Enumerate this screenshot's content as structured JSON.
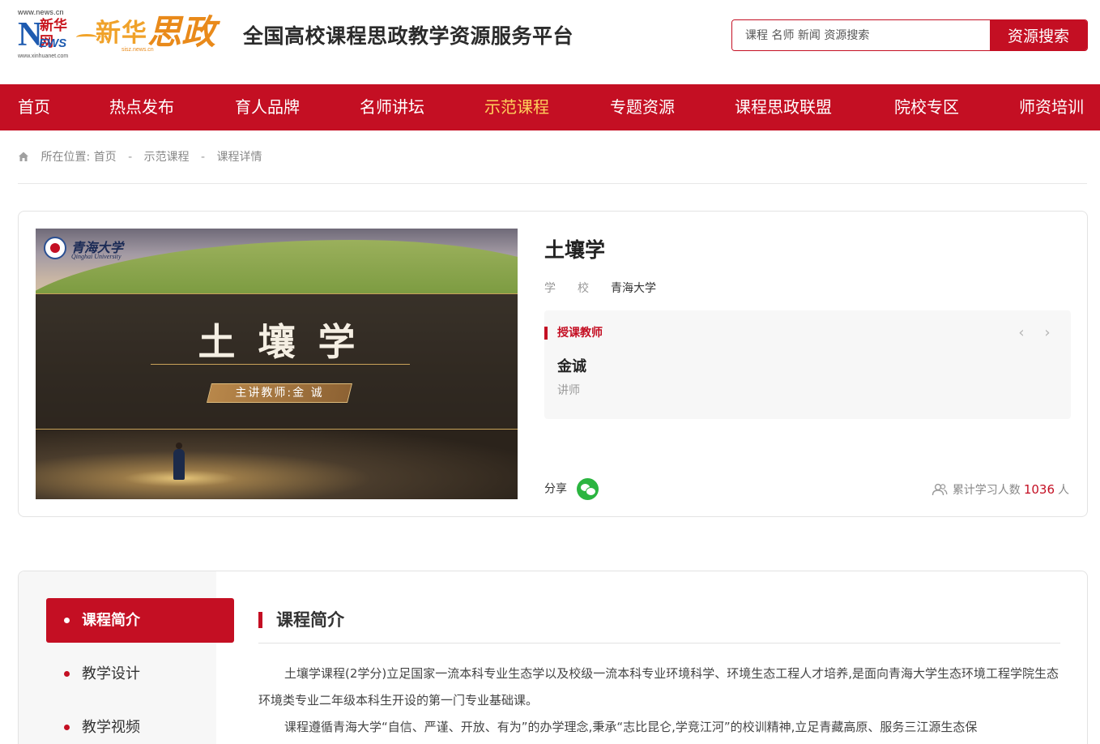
{
  "header": {
    "logo_news_url_top": "www.news.cn",
    "logo_news_cn": "新华网",
    "logo_news_en_n": "N",
    "logo_news_en_rest": "EWS",
    "logo_news_url_bottom": "www.xinhuanet.com",
    "logo_xh": "新华",
    "logo_sz": "思政",
    "logo_sz_url": "sisz.news.cn",
    "site_title": "全国高校课程思政教学资源服务平台",
    "search_placeholder": "课程 名师 新闻 资源搜索",
    "search_button": "资源搜索"
  },
  "nav": {
    "items": [
      {
        "label": "首页"
      },
      {
        "label": "热点发布"
      },
      {
        "label": "育人品牌"
      },
      {
        "label": "名师讲坛"
      },
      {
        "label": "示范课程"
      },
      {
        "label": "专题资源"
      },
      {
        "label": "课程思政联盟"
      },
      {
        "label": "院校专区"
      },
      {
        "label": "师资培训"
      }
    ],
    "active": "示范课程"
  },
  "breadcrumb": {
    "prefix": "所在位置:",
    "items": [
      "首页",
      "示范课程",
      "课程详情"
    ],
    "separator": "-"
  },
  "course": {
    "cover": {
      "university_cn": "青海大学",
      "university_en": "Qinghai University",
      "title": "土壤学",
      "teacher_tag": "主讲教师:金 诚"
    },
    "title": "土壤学",
    "school_label": "学校",
    "school_value": "青海大学",
    "teacher_header": "授课教师",
    "teacher_name": "金诚",
    "teacher_rank": "讲师",
    "prev_arrow": "‹",
    "next_arrow": "›",
    "share_label": "分享",
    "learn_label": "累计学习人数",
    "learn_count": "1036",
    "learn_unit": "人"
  },
  "detail": {
    "side_items": [
      {
        "label": "课程简介"
      },
      {
        "label": "教学设计"
      },
      {
        "label": "教学视频"
      }
    ],
    "active": "课程简介",
    "section_title": "课程简介",
    "paragraphs": [
      "土壤学课程(2学分)立足国家一流本科专业生态学以及校级一流本科专业环境科学、环境生态工程人才培养,是面向青海大学生态环境工程学院生态环境类专业二年级本科生开设的第一门专业基础课。",
      "课程遵循青海大学“自信、严谨、开放、有为”的办学理念,秉承“志比昆仑,学竞江河”的校训精神,立足青藏高原、服务三江源生态保"
    ]
  },
  "colors": {
    "brand_red": "#c40f23",
    "nav_active": "#ffd15c",
    "wechat_green": "#2bb540"
  }
}
